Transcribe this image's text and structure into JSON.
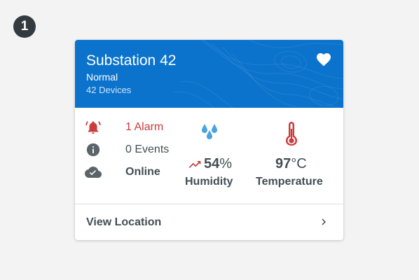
{
  "step_badge": "1",
  "header": {
    "title": "Substation 42",
    "status": "Normal",
    "devices": "42 Devices",
    "background_color": "#0b73cc"
  },
  "status_list": [
    {
      "icon": "alarm-bell-icon",
      "label": "1 Alarm",
      "color": "#ca3c3d"
    },
    {
      "icon": "info-icon",
      "label": "0 Events",
      "color": "#5b6469"
    },
    {
      "icon": "cloud-check-icon",
      "label": "Online",
      "color": "#5b6469"
    }
  ],
  "metrics": {
    "humidity": {
      "value": "54",
      "unit": "%",
      "label": "Humidity",
      "trend_icon": "trending-up-icon",
      "icon": "water-drops-icon",
      "icon_color": "#4aa3df"
    },
    "temperature": {
      "value": "97",
      "unit": "°C",
      "label": "Temperature",
      "icon": "thermometer-icon",
      "icon_color": "#ca3c3d"
    }
  },
  "footer": {
    "label": "View Location"
  },
  "colors": {
    "text": "#424e54",
    "alarm": "#ca3c3d",
    "background": "#f3f3f3"
  }
}
